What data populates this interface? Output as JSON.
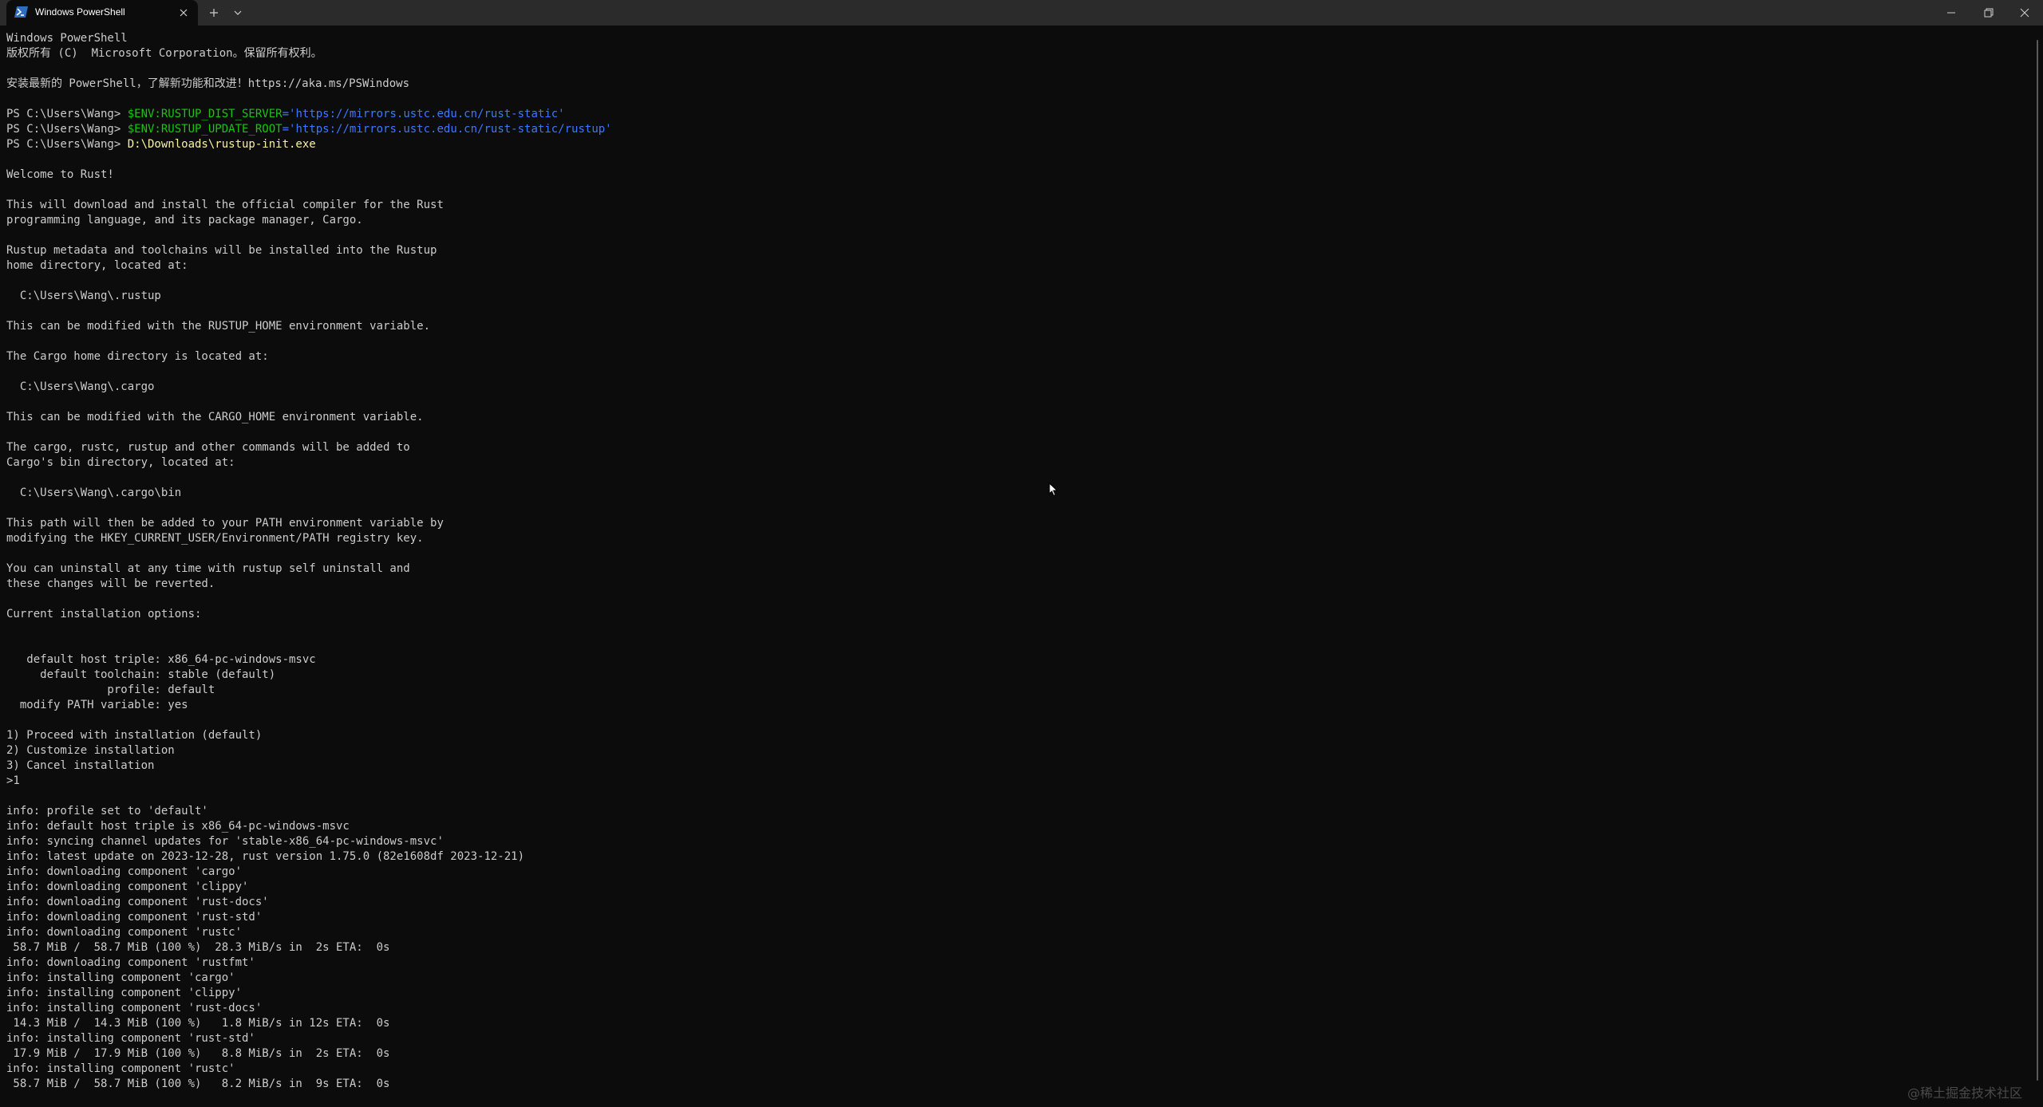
{
  "app": {
    "tab_title": "Windows PowerShell",
    "tab_icon": "powershell-icon",
    "title_buttons": [
      "close-icon",
      "plus-icon",
      "chevron-down-icon"
    ],
    "window_buttons": [
      "minimize-icon",
      "restore-icon",
      "close-icon"
    ]
  },
  "colors": {
    "background": "#0c0c0c",
    "titlebar": "#2b2b2b",
    "text": "#cccccc",
    "command": "#f9f1a5",
    "variable": "#16c60c",
    "string": "#3b78ff"
  },
  "console": {
    "lines": [
      "Windows PowerShell",
      "版权所有 (C)  Microsoft Corporation。保留所有权利。",
      "",
      "安装最新的 PowerShell，了解新功能和改进！https://aka.ms/PSWindows",
      "",
      {
        "prompt": "PS C:\\Users\\Wang> ",
        "var": "$ENV:RUSTUP_DIST_SERVER",
        "op": "=",
        "str": "'https://mirrors.ustc.edu.cn/rust-static'"
      },
      {
        "prompt": "PS C:\\Users\\Wang> ",
        "var": "$ENV:RUSTUP_UPDATE_ROOT",
        "op": "=",
        "str": "'https://mirrors.ustc.edu.cn/rust-static/rustup'"
      },
      {
        "prompt": "PS C:\\Users\\Wang> ",
        "cmd": "D:\\Downloads\\rustup-init.exe"
      },
      "",
      "Welcome to Rust!",
      "",
      "This will download and install the official compiler for the Rust",
      "programming language, and its package manager, Cargo.",
      "",
      "Rustup metadata and toolchains will be installed into the Rustup",
      "home directory, located at:",
      "",
      "  C:\\Users\\Wang\\.rustup",
      "",
      "This can be modified with the RUSTUP_HOME environment variable.",
      "",
      "The Cargo home directory is located at:",
      "",
      "  C:\\Users\\Wang\\.cargo",
      "",
      "This can be modified with the CARGO_HOME environment variable.",
      "",
      "The cargo, rustc, rustup and other commands will be added to",
      "Cargo's bin directory, located at:",
      "",
      "  C:\\Users\\Wang\\.cargo\\bin",
      "",
      "This path will then be added to your PATH environment variable by",
      "modifying the HKEY_CURRENT_USER/Environment/PATH registry key.",
      "",
      "You can uninstall at any time with rustup self uninstall and",
      "these changes will be reverted.",
      "",
      "Current installation options:",
      "",
      "",
      "   default host triple: x86_64-pc-windows-msvc",
      "     default toolchain: stable (default)",
      "               profile: default",
      "  modify PATH variable: yes",
      "",
      "1) Proceed with installation (default)",
      "2) Customize installation",
      "3) Cancel installation",
      ">1",
      "",
      "info: profile set to 'default'",
      "info: default host triple is x86_64-pc-windows-msvc",
      "info: syncing channel updates for 'stable-x86_64-pc-windows-msvc'",
      "info: latest update on 2023-12-28, rust version 1.75.0 (82e1608df 2023-12-21)",
      "info: downloading component 'cargo'",
      "info: downloading component 'clippy'",
      "info: downloading component 'rust-docs'",
      "info: downloading component 'rust-std'",
      "info: downloading component 'rustc'",
      " 58.7 MiB /  58.7 MiB (100 %)  28.3 MiB/s in  2s ETA:  0s",
      "info: downloading component 'rustfmt'",
      "info: installing component 'cargo'",
      "info: installing component 'clippy'",
      "info: installing component 'rust-docs'",
      " 14.3 MiB /  14.3 MiB (100 %)   1.8 MiB/s in 12s ETA:  0s",
      "info: installing component 'rust-std'",
      " 17.9 MiB /  17.9 MiB (100 %)   8.8 MiB/s in  2s ETA:  0s",
      "info: installing component 'rustc'",
      " 58.7 MiB /  58.7 MiB (100 %)   8.2 MiB/s in  9s ETA:  0s"
    ]
  },
  "watermark": "@稀土掘金技术社区",
  "cursor_icon": "mouse-pointer-icon"
}
